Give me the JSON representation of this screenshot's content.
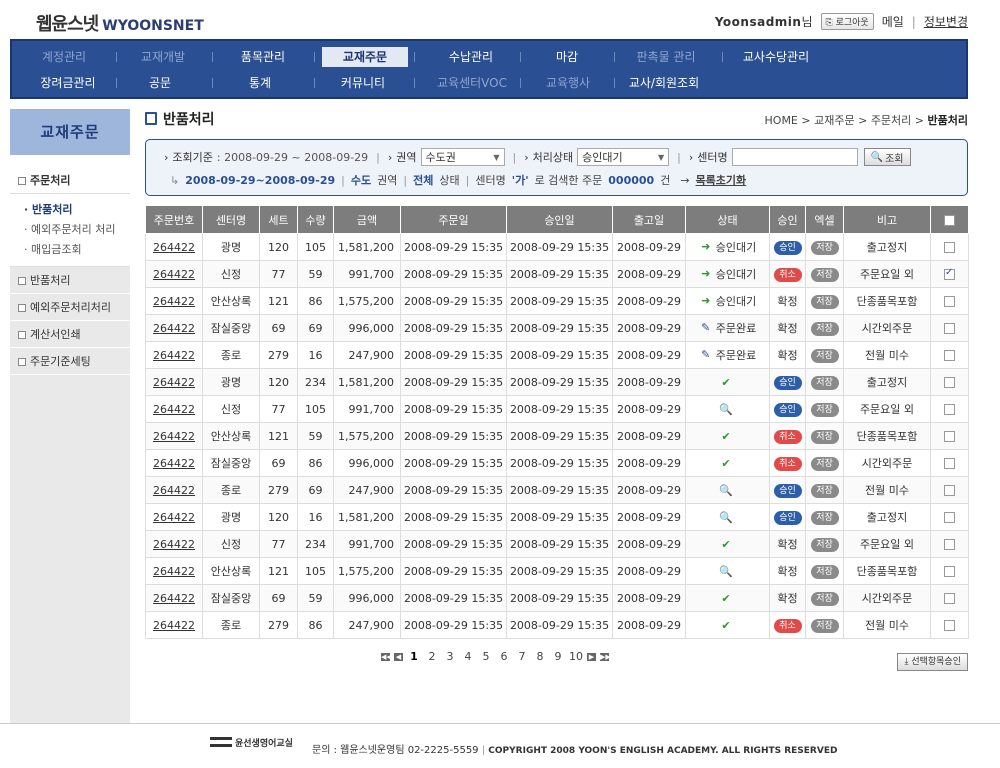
{
  "header": {
    "logo_ko": "웹윤스넷",
    "logo_en": "WYOONSNET",
    "user_id": "Yoonsadmin",
    "user_suffix": "님",
    "logout_label": "로그아웃",
    "mail_label": "메일",
    "profile_label": "정보변경"
  },
  "gnb": {
    "row1": [
      "계정관리",
      "교재개발",
      "품목관리",
      "교재주문",
      "수납관리",
      "마감",
      "판촉물 관리",
      "교사수당관리"
    ],
    "row2": [
      "장려금관리",
      "공문",
      "통계",
      "커뮤니티",
      "교육센터VOC",
      "교육행사",
      "교사/회원조회"
    ]
  },
  "sidebar": {
    "title": "교재주문",
    "main_item": "주문처리",
    "sub_items": [
      "반품처리",
      "예외주문처리 처리",
      "매입금조회"
    ],
    "items": [
      "반품처리",
      "예외주문처리처리",
      "계산서인쇄",
      "주문기준세팅"
    ]
  },
  "page": {
    "title": "반품처리",
    "breadcrumb": [
      "HOME",
      "교재주문",
      "주문처리",
      "반품처리"
    ]
  },
  "search": {
    "period_label": "조회기준",
    "period_value": ": 2008-09-29 ~ 2008-09-29",
    "region_label": "권역",
    "region_value": "수도권",
    "status_label": "처리상태",
    "status_value": "승인대기",
    "center_label": "센터명",
    "search_button": "조회",
    "summary_period": "2008-09-29~2008-09-29",
    "summary_region": "수도",
    "summary_region_suffix": "권역",
    "summary_status": "전체",
    "summary_status_suffix": "상태",
    "summary_center_prefix": "센터명",
    "summary_center": "'가'",
    "summary_center_suffix": "로 검색한 주문",
    "summary_count": "000000",
    "summary_count_suffix": "건",
    "reset_label": "목록초기화"
  },
  "table": {
    "headers": [
      "주문번호",
      "센터명",
      "세트",
      "수량",
      "금액",
      "주문일",
      "승인일",
      "출고일",
      "상태",
      "승인",
      "엑셀",
      "비고"
    ],
    "rows": [
      {
        "no": "264422",
        "center": "광명",
        "set": "120",
        "qty": "105",
        "amount": "1,581,200",
        "order": "2008-09-29 15:35",
        "approve": "2008-09-29 15:35",
        "ship": "2008-09-29",
        "status_icon": "go-icon",
        "status": "승인대기",
        "appr": "승인",
        "appr_type": "ok",
        "excel": "저장",
        "note": "출고정지",
        "checked": false
      },
      {
        "no": "264422",
        "center": "신정",
        "set": "77",
        "qty": "59",
        "amount": "991,700",
        "order": "2008-09-29 15:35",
        "approve": "2008-09-29 15:35",
        "ship": "2008-09-29",
        "status_icon": "go-icon",
        "status": "승인대기",
        "appr": "취소",
        "appr_type": "cancel",
        "excel": "저장",
        "note": "주문요일 외",
        "checked": true
      },
      {
        "no": "264422",
        "center": "안산상록",
        "set": "121",
        "qty": "86",
        "amount": "1,575,200",
        "order": "2008-09-29 15:35",
        "approve": "2008-09-29 15:35",
        "ship": "2008-09-29",
        "status_icon": "go-icon",
        "status": "승인대기",
        "appr": "확정",
        "appr_type": "text",
        "excel": "저장",
        "note": "단종품목포함",
        "checked": false
      },
      {
        "no": "264422",
        "center": "잠실중앙",
        "set": "69",
        "qty": "69",
        "amount": "996,000",
        "order": "2008-09-29 15:35",
        "approve": "2008-09-29 15:35",
        "ship": "2008-09-29",
        "status_icon": "edit-icon",
        "status": "주문완료",
        "appr": "확정",
        "appr_type": "text",
        "excel": "저장",
        "note": "시간외주문",
        "checked": false
      },
      {
        "no": "264422",
        "center": "종로",
        "set": "279",
        "qty": "16",
        "amount": "247,900",
        "order": "2008-09-29 15:35",
        "approve": "2008-09-29 15:35",
        "ship": "2008-09-29",
        "status_icon": "edit-icon",
        "status": "주문완료",
        "appr": "확정",
        "appr_type": "text",
        "excel": "저장",
        "note": "전월 미수",
        "checked": false
      },
      {
        "no": "264422",
        "center": "광명",
        "set": "120",
        "qty": "234",
        "amount": "1,581,200",
        "order": "2008-09-29 15:35",
        "approve": "2008-09-29 15:35",
        "ship": "2008-09-29",
        "status_icon": "check-icon",
        "status": "",
        "appr": "승인",
        "appr_type": "ok",
        "excel": "저장",
        "note": "출고정지",
        "checked": false
      },
      {
        "no": "264422",
        "center": "신정",
        "set": "77",
        "qty": "105",
        "amount": "991,700",
        "order": "2008-09-29 15:35",
        "approve": "2008-09-29 15:35",
        "ship": "2008-09-29",
        "status_icon": "magnifier-icon",
        "status": "",
        "appr": "승인",
        "appr_type": "ok",
        "excel": "저장",
        "note": "주문요일 외",
        "checked": false
      },
      {
        "no": "264422",
        "center": "안산상록",
        "set": "121",
        "qty": "59",
        "amount": "1,575,200",
        "order": "2008-09-29 15:35",
        "approve": "2008-09-29 15:35",
        "ship": "2008-09-29",
        "status_icon": "check-icon",
        "status": "",
        "appr": "취소",
        "appr_type": "cancel",
        "excel": "저장",
        "note": "단종품목포함",
        "checked": false
      },
      {
        "no": "264422",
        "center": "잠실중앙",
        "set": "69",
        "qty": "86",
        "amount": "996,000",
        "order": "2008-09-29 15:35",
        "approve": "2008-09-29 15:35",
        "ship": "2008-09-29",
        "status_icon": "check-icon",
        "status": "",
        "appr": "취소",
        "appr_type": "cancel",
        "excel": "저장",
        "note": "시간외주문",
        "checked": false
      },
      {
        "no": "264422",
        "center": "종로",
        "set": "279",
        "qty": "69",
        "amount": "247,900",
        "order": "2008-09-29 15:35",
        "approve": "2008-09-29 15:35",
        "ship": "2008-09-29",
        "status_icon": "magnifier-icon",
        "status": "",
        "appr": "승인",
        "appr_type": "ok",
        "excel": "저장",
        "note": "전월 미수",
        "checked": false
      },
      {
        "no": "264422",
        "center": "광명",
        "set": "120",
        "qty": "16",
        "amount": "1,581,200",
        "order": "2008-09-29 15:35",
        "approve": "2008-09-29 15:35",
        "ship": "2008-09-29",
        "status_icon": "magnifier-icon",
        "status": "",
        "appr": "승인",
        "appr_type": "ok",
        "excel": "저장",
        "note": "출고정지",
        "checked": false
      },
      {
        "no": "264422",
        "center": "신정",
        "set": "77",
        "qty": "234",
        "amount": "991,700",
        "order": "2008-09-29 15:35",
        "approve": "2008-09-29 15:35",
        "ship": "2008-09-29",
        "status_icon": "check-icon",
        "status": "",
        "appr": "확정",
        "appr_type": "text",
        "excel": "저장",
        "note": "주문요일 외",
        "checked": false
      },
      {
        "no": "264422",
        "center": "안산상록",
        "set": "121",
        "qty": "105",
        "amount": "1,575,200",
        "order": "2008-09-29 15:35",
        "approve": "2008-09-29 15:35",
        "ship": "2008-09-29",
        "status_icon": "magnifier-icon",
        "status": "",
        "appr": "확정",
        "appr_type": "text",
        "excel": "저장",
        "note": "단종품목포함",
        "checked": false
      },
      {
        "no": "264422",
        "center": "잠실중앙",
        "set": "69",
        "qty": "59",
        "amount": "996,000",
        "order": "2008-09-29 15:35",
        "approve": "2008-09-29 15:35",
        "ship": "2008-09-29",
        "status_icon": "check-icon",
        "status": "",
        "appr": "확정",
        "appr_type": "text",
        "excel": "저장",
        "note": "시간외주문",
        "checked": false
      },
      {
        "no": "264422",
        "center": "종로",
        "set": "279",
        "qty": "86",
        "amount": "247,900",
        "order": "2008-09-29 15:35",
        "approve": "2008-09-29 15:35",
        "ship": "2008-09-29",
        "status_icon": "check-icon",
        "status": "",
        "appr": "취소",
        "appr_type": "cancel",
        "excel": "저장",
        "note": "전월 미수",
        "checked": false
      }
    ]
  },
  "pager": {
    "pages": [
      "1",
      "2",
      "3",
      "4",
      "5",
      "6",
      "7",
      "8",
      "9",
      "10"
    ],
    "current": "1"
  },
  "approve_selected_label": "선택항목승인",
  "footer": {
    "logo": "윤선생영어교실",
    "contact": "문의 : 웹윤스넷운영팀 02-2225-5559",
    "copyright": "COPYRIGHT 2008 YOON'S ENGLISH ACADEMY. ALL RIGHTS RESERVED"
  }
}
